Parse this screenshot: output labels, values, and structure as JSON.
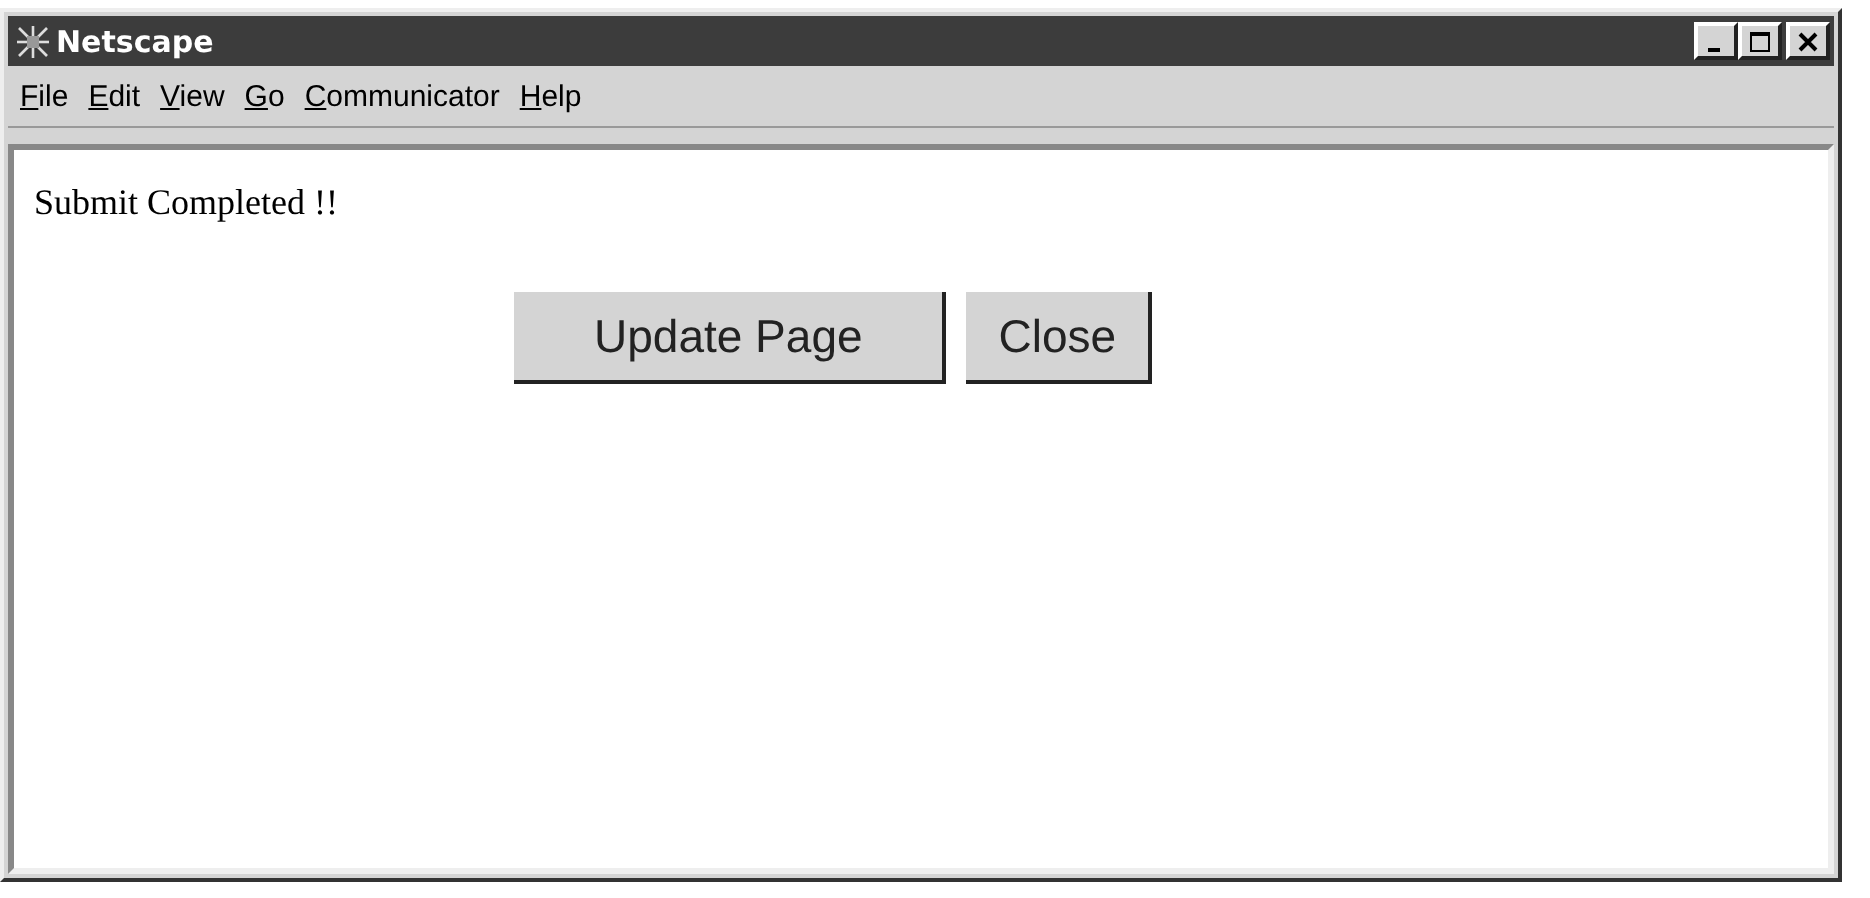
{
  "window": {
    "title": "Netscape"
  },
  "menu": [
    {
      "label": "File"
    },
    {
      "label": "Edit"
    },
    {
      "label": "View"
    },
    {
      "label": "Go"
    },
    {
      "label": "Communicator"
    },
    {
      "label": "Help"
    }
  ],
  "content": {
    "message": "Submit Completed !!",
    "buttons": [
      {
        "label": "Update Page"
      },
      {
        "label": "Close"
      }
    ]
  }
}
